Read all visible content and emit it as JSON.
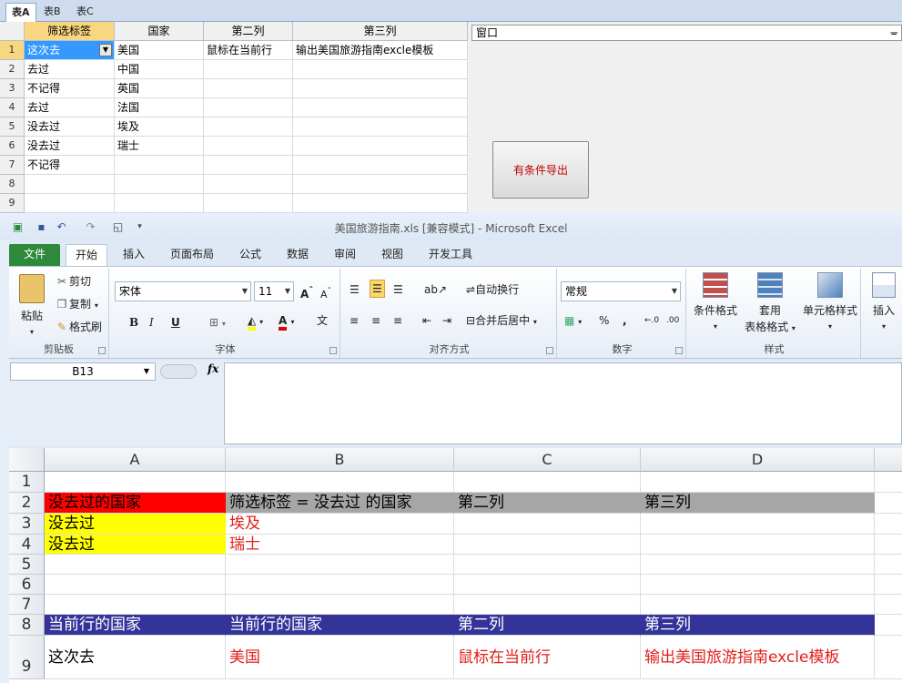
{
  "top_tabs": [
    "表A",
    "表B",
    "表C"
  ],
  "top_grid": {
    "headers": [
      "筛选标签",
      "国家",
      "第二列",
      "第三列"
    ],
    "row_numbers": [
      "1",
      "2",
      "3",
      "4",
      "5",
      "6",
      "7",
      "8",
      "9"
    ],
    "rows": [
      [
        "这次去",
        "美国",
        "鼠标在当前行",
        "输出美国旅游指南excle模板"
      ],
      [
        "去过",
        "中国",
        "",
        ""
      ],
      [
        "不记得",
        "英国",
        "",
        ""
      ],
      [
        "去过",
        "法国",
        "",
        ""
      ],
      [
        "没去过",
        "埃及",
        "",
        ""
      ],
      [
        "没去过",
        "瑞士",
        "",
        ""
      ],
      [
        "不记得",
        "",
        "",
        ""
      ],
      [
        "",
        "",
        "",
        ""
      ],
      [
        "",
        "",
        "",
        ""
      ]
    ]
  },
  "window_panel": {
    "title": "窗口",
    "pin": "ᚚ",
    "export_button": "有条件导出"
  },
  "excel": {
    "title": "美国旅游指南.xls  [兼容模式]  -  Microsoft Excel",
    "ribbon_tabs": [
      "文件",
      "开始",
      "插入",
      "页面布局",
      "公式",
      "数据",
      "审阅",
      "视图",
      "开发工具"
    ],
    "clipboard": {
      "label": "剪贴板",
      "paste": "粘贴",
      "cut": "剪切",
      "copy": "复制",
      "format_painter": "格式刷"
    },
    "font": {
      "label": "字体",
      "name": "宋体",
      "size": "11",
      "bold": "B",
      "italic": "I",
      "underline": "U"
    },
    "alignment": {
      "label": "对齐方式",
      "wrap": "自动换行",
      "merge": "合并后居中"
    },
    "number": {
      "label": "数字",
      "format": "常规",
      "percent": "%",
      "comma": ","
    },
    "styles": {
      "label": "样式",
      "conditional": "条件格式",
      "table_1": "套用",
      "table_2": "表格格式",
      "cell_styles": "单元格样式"
    },
    "cells": {
      "insert": "插入"
    },
    "name_box": "B13",
    "fx": "fx"
  },
  "sheet": {
    "col_headers": [
      "A",
      "B",
      "C",
      "D"
    ],
    "row_headers": [
      "1",
      "2",
      "3",
      "4",
      "5",
      "6",
      "7",
      "8",
      "9"
    ],
    "r2": [
      "没去过的国家",
      "筛选标签 = 没去过 的国家",
      "第二列",
      "第三列"
    ],
    "r3": [
      "没去过",
      "埃及"
    ],
    "r4": [
      "没去过",
      "瑞士"
    ],
    "r8": [
      "当前行的国家",
      "当前行的国家",
      "第二列",
      "第三列"
    ],
    "r9": [
      "这次去",
      "美国",
      "鼠标在当前行",
      "输出美国旅游指南excle模板"
    ]
  },
  "colors": {
    "red_fill": "#ff0000",
    "yellow_fill": "#ffff00",
    "gray_fill": "#a6a6a6",
    "navy_fill": "#333399",
    "red_text": "#e0201b"
  }
}
